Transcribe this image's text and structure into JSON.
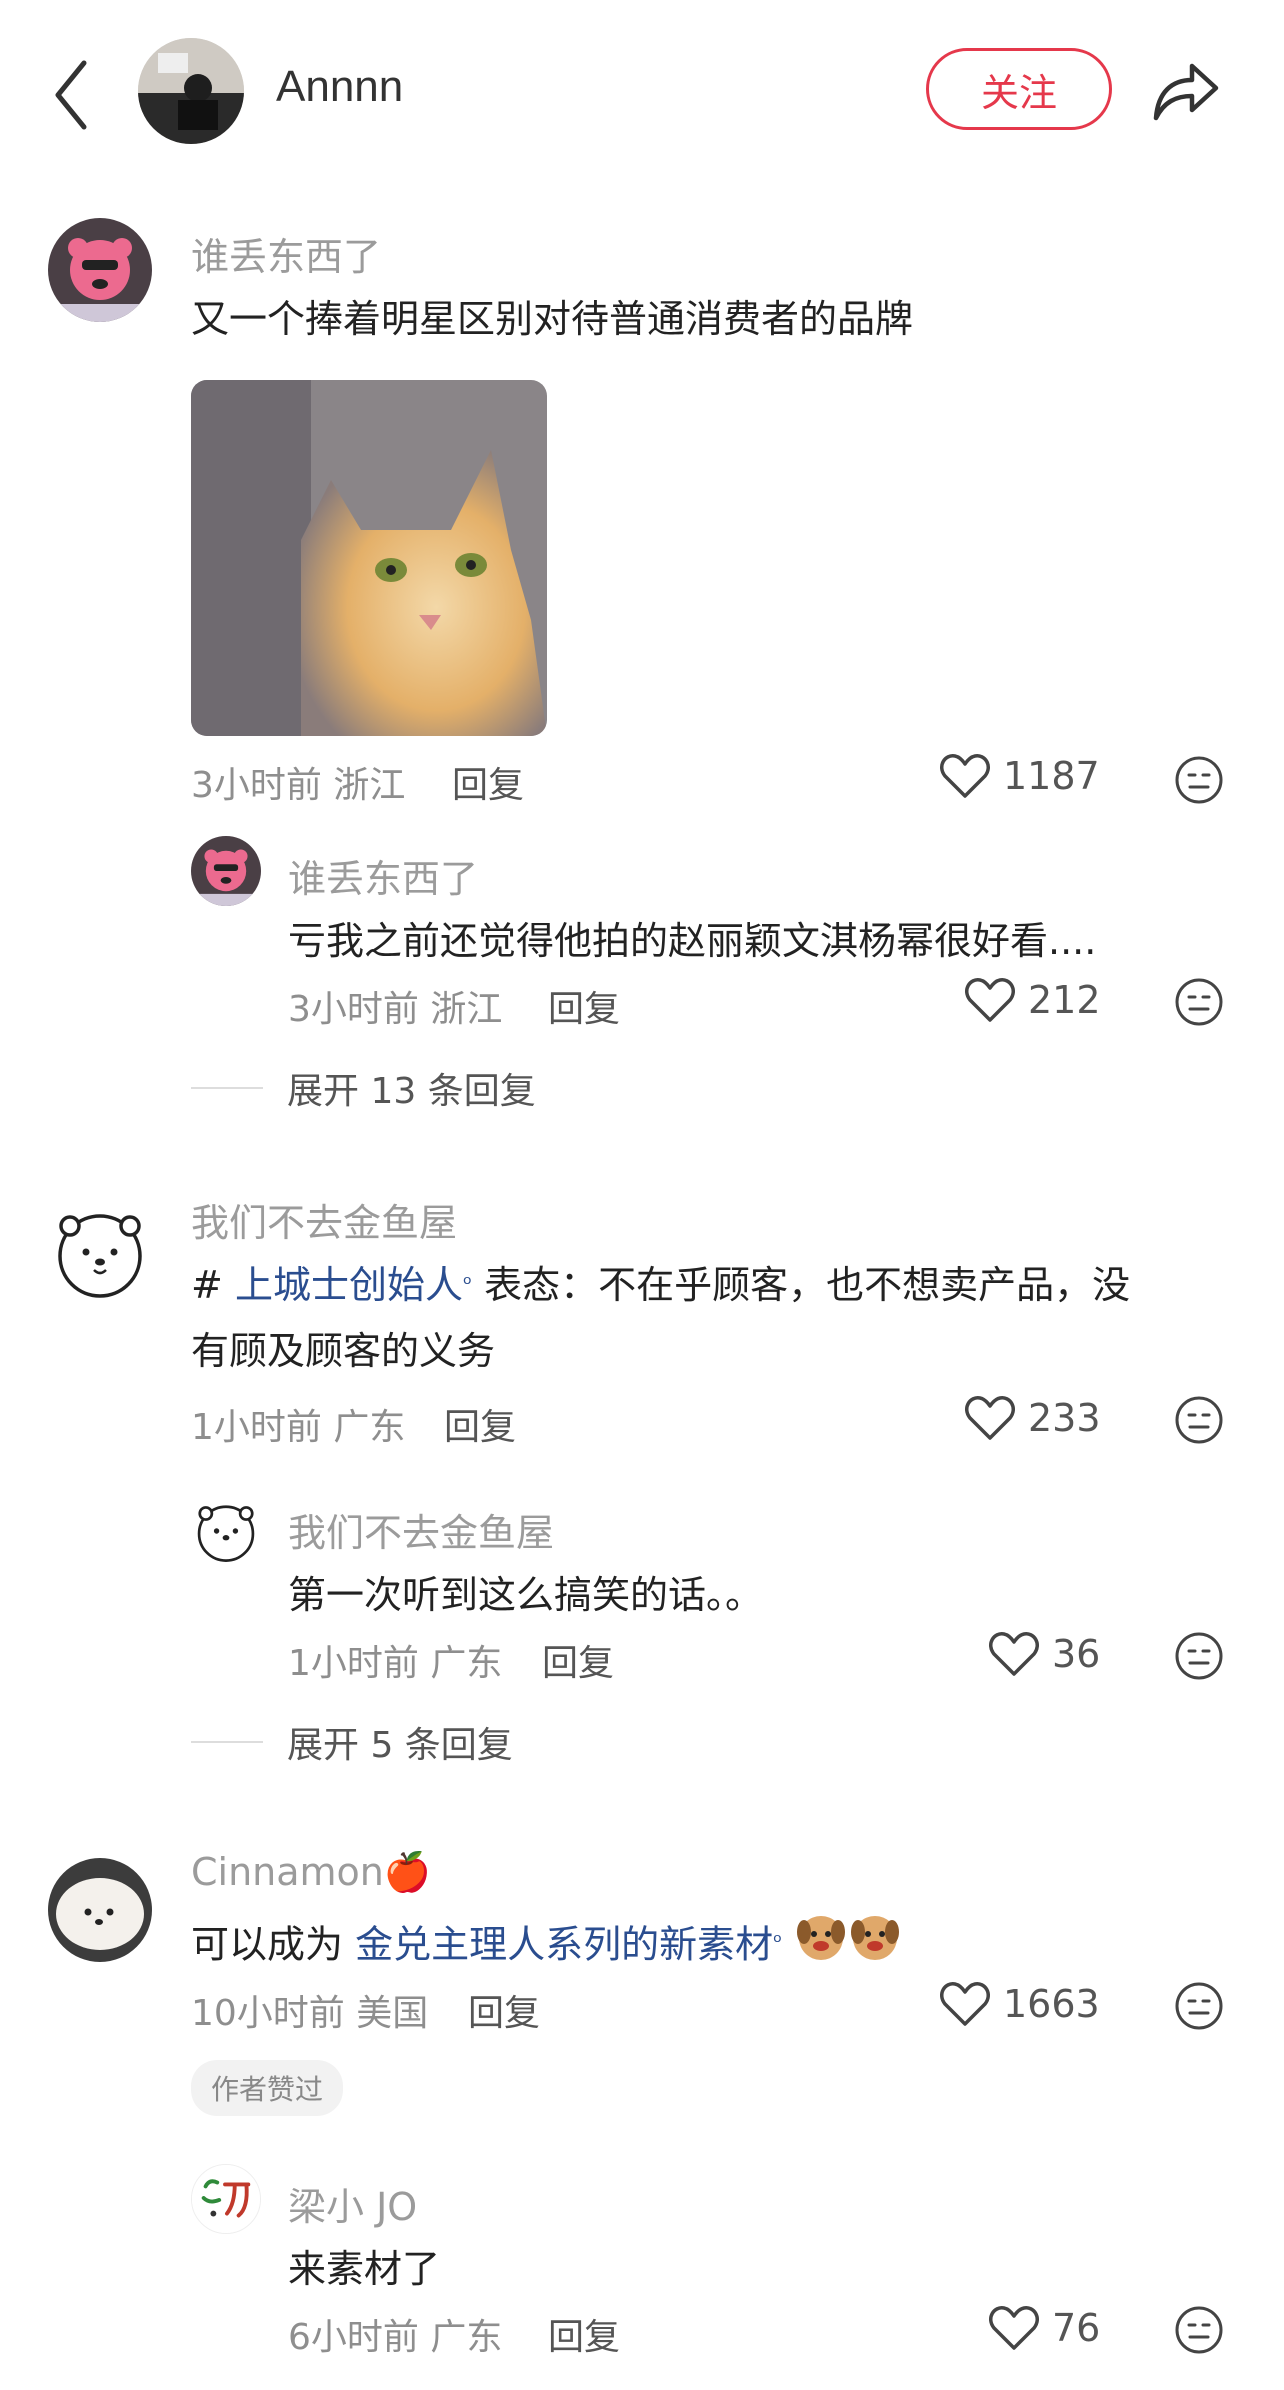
{
  "header": {
    "username": "Annnn",
    "follow_label": "关注"
  },
  "comments": [
    {
      "user": "谁丢东西了",
      "text": "又一个捧着明星区别对待普通消费者的品牌",
      "time": "3小时前",
      "location": "浙江",
      "reply_label": "回复",
      "likes": "1187",
      "replies": [
        {
          "user": "谁丢东西了",
          "text": "亏我之前还觉得他拍的赵丽颖文淇杨幂很好看....",
          "time": "3小时前",
          "location": "浙江",
          "reply_label": "回复",
          "likes": "212"
        }
      ],
      "expand_label": "展开 13 条回复"
    },
    {
      "user": "我们不去金鱼屋",
      "hash": "#",
      "topic": "上城士创始人",
      "text_after_topic": "表态：不在乎顾客，也不想卖产品，没",
      "text_line2": "有顾及顾客的义务",
      "time": "1小时前",
      "location": "广东",
      "reply_label": "回复",
      "likes": "233",
      "replies": [
        {
          "user": "我们不去金鱼屋",
          "text": "第一次听到这么搞笑的话。。",
          "time": "1小时前",
          "location": "广东",
          "reply_label": "回复",
          "likes": "36"
        }
      ],
      "expand_label": "展开 5 条回复"
    },
    {
      "user": "Cinnamon",
      "user_emoji": "🍎",
      "text_before_topic": "可以成为",
      "topic": "金兑主理人系列的新素材",
      "time": "10小时前",
      "location": "美国",
      "reply_label": "回复",
      "likes": "1663",
      "badge": "作者赞过",
      "replies": [
        {
          "user": "梁小 JO",
          "text": "来素材了",
          "time": "6小时前",
          "location": "广东",
          "reply_label": "回复",
          "likes": "76"
        }
      ]
    }
  ],
  "colors": {
    "accent": "#e5384b",
    "topic": "#2a4d8f",
    "meta": "#8e8e8e"
  }
}
